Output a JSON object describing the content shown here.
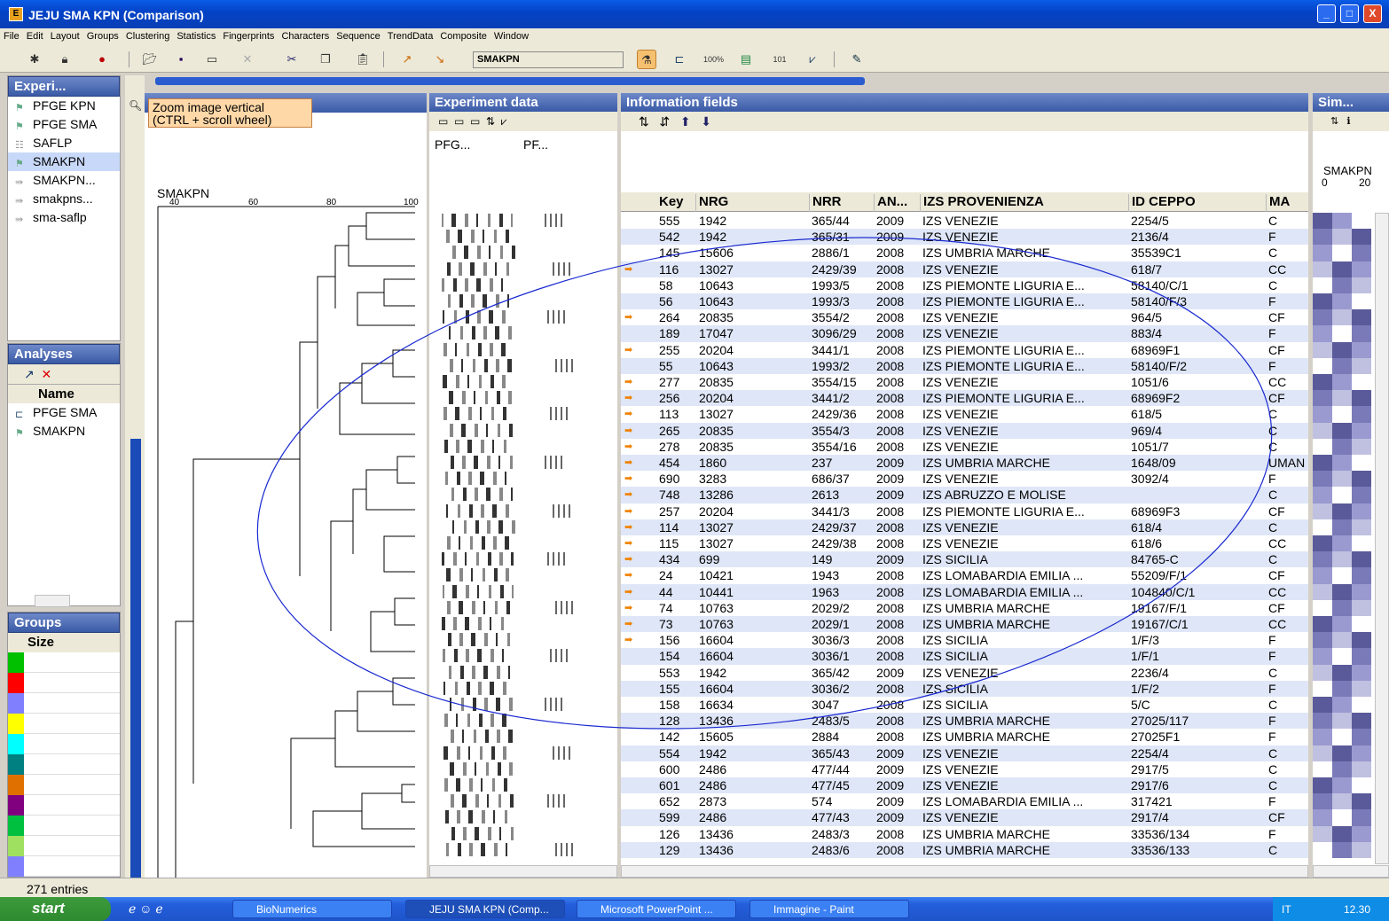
{
  "window": {
    "title": "JEJU SMA KPN (Comparison)",
    "icon_text": "E",
    "min": "_",
    "max": "□",
    "close": "X"
  },
  "menu": [
    "File",
    "Edit",
    "Layout",
    "Groups",
    "Clustering",
    "Statistics",
    "Fingerprints",
    "Characters",
    "Sequence",
    "TrendData",
    "Composite",
    "Window"
  ],
  "toolbar": {
    "db_name": "SMAKPN"
  },
  "experiments": {
    "header": "Experi...",
    "items": [
      {
        "label": "PFGE KPN",
        "icon": "fingerprint-icon"
      },
      {
        "label": "PFGE SMA",
        "icon": "fingerprint-icon"
      },
      {
        "label": "SAFLP",
        "icon": "character-icon"
      },
      {
        "label": "SMAKPN",
        "icon": "composite-icon",
        "selected": true
      },
      {
        "label": "SMAKPN...",
        "icon": "composite-icon"
      },
      {
        "label": "smakpns...",
        "icon": "composite-icon"
      },
      {
        "label": "sma-saflp",
        "icon": "composite-icon"
      }
    ]
  },
  "analyses": {
    "header": "Analyses",
    "col": "Name",
    "items": [
      {
        "label": "PFGE SMA"
      },
      {
        "label": "SMAKPN"
      }
    ]
  },
  "groups": {
    "header": "Groups",
    "col": "Size",
    "colors": [
      "#00c000",
      "#ff0000",
      "#8080ff",
      "#ffff00",
      "#00ffff",
      "#008080",
      "#e07000",
      "#800080",
      "#00c040",
      "#a0e060",
      "#8080ff"
    ]
  },
  "tooltip": {
    "line1": "Zoom image vertical",
    "line2": "(CTRL + scroll wheel)"
  },
  "dendrogram": {
    "label": "SMAKPN",
    "ticks": [
      "40",
      "60",
      "80",
      "100"
    ]
  },
  "experiment_data": {
    "header": "Experiment data",
    "col1": "PFG...",
    "col2": "PF..."
  },
  "info_fields": {
    "header": "Information fields",
    "columns": [
      "Key",
      "NRG",
      "NRR",
      "AN...",
      "IZS PROVENIENZA",
      "ID CEPPO",
      "MA"
    ]
  },
  "similarity": {
    "header": "Sim...",
    "label": "SMAKPN",
    "ticks": [
      "0",
      "20"
    ]
  },
  "rows": [
    [
      "555",
      "1942",
      "365/44",
      "2009",
      "IZS VENEZIE",
      "2254/5",
      "C",
      false
    ],
    [
      "542",
      "1942",
      "365/31",
      "2009",
      "IZS VENEZIE",
      "2136/4",
      "F",
      false
    ],
    [
      "145",
      "15606",
      "2886/1",
      "2008",
      "IZS UMBRIA MARCHE",
      "35539C1",
      "C",
      false
    ],
    [
      "116",
      "13027",
      "2429/39",
      "2008",
      "IZS VENEZIE",
      "618/7",
      "CC",
      true
    ],
    [
      "58",
      "10643",
      "1993/5",
      "2008",
      "IZS PIEMONTE LIGURIA E...",
      "58140/C/1",
      "C",
      false
    ],
    [
      "56",
      "10643",
      "1993/3",
      "2008",
      "IZS PIEMONTE LIGURIA E...",
      "58140/F/3",
      "F",
      false
    ],
    [
      "264",
      "20835",
      "3554/2",
      "2008",
      "IZS VENEZIE",
      "964/5",
      "CF",
      true
    ],
    [
      "189",
      "17047",
      "3096/29",
      "2008",
      "IZS VENEZIE",
      "883/4",
      "F",
      false
    ],
    [
      "255",
      "20204",
      "3441/1",
      "2008",
      "IZS PIEMONTE LIGURIA E...",
      "68969F1",
      "CF",
      true
    ],
    [
      "55",
      "10643",
      "1993/2",
      "2008",
      "IZS PIEMONTE LIGURIA E...",
      "58140/F/2",
      "F",
      false
    ],
    [
      "277",
      "20835",
      "3554/15",
      "2008",
      "IZS VENEZIE",
      "1051/6",
      "CC",
      true
    ],
    [
      "256",
      "20204",
      "3441/2",
      "2008",
      "IZS PIEMONTE LIGURIA E...",
      "68969F2",
      "CF",
      true
    ],
    [
      "113",
      "13027",
      "2429/36",
      "2008",
      "IZS VENEZIE",
      "618/5",
      "C",
      true
    ],
    [
      "265",
      "20835",
      "3554/3",
      "2008",
      "IZS VENEZIE",
      "969/4",
      "C",
      true
    ],
    [
      "278",
      "20835",
      "3554/16",
      "2008",
      "IZS VENEZIE",
      "1051/7",
      "C",
      true
    ],
    [
      "454",
      "1860",
      "237",
      "2009",
      "IZS UMBRIA MARCHE",
      "1648/09",
      "UMAN",
      true
    ],
    [
      "690",
      "3283",
      "686/37",
      "2009",
      "IZS VENEZIE",
      "3092/4",
      "F",
      true
    ],
    [
      "748",
      "13286",
      "2613",
      "2009",
      "IZS ABRUZZO E MOLISE",
      "",
      "C",
      true
    ],
    [
      "257",
      "20204",
      "3441/3",
      "2008",
      "IZS PIEMONTE LIGURIA E...",
      "68969F3",
      "CF",
      true
    ],
    [
      "114",
      "13027",
      "2429/37",
      "2008",
      "IZS VENEZIE",
      "618/4",
      "C",
      true
    ],
    [
      "115",
      "13027",
      "2429/38",
      "2008",
      "IZS VENEZIE",
      "618/6",
      "CC",
      true
    ],
    [
      "434",
      "699",
      "149",
      "2009",
      "IZS SICILIA",
      "84765-C",
      "C",
      true
    ],
    [
      "24",
      "10421",
      "1943",
      "2008",
      "IZS LOMABARDIA EMILIA ...",
      "55209/F/1",
      "CF",
      true
    ],
    [
      "44",
      "10441",
      "1963",
      "2008",
      "IZS LOMABARDIA EMILIA ...",
      "104840/C/1",
      "CC",
      true
    ],
    [
      "74",
      "10763",
      "2029/2",
      "2008",
      "IZS UMBRIA MARCHE",
      "19167/F/1",
      "CF",
      true
    ],
    [
      "73",
      "10763",
      "2029/1",
      "2008",
      "IZS UMBRIA MARCHE",
      "19167/C/1",
      "CC",
      true
    ],
    [
      "156",
      "16604",
      "3036/3",
      "2008",
      "IZS SICILIA",
      "1/F/3",
      "F",
      true
    ],
    [
      "154",
      "16604",
      "3036/1",
      "2008",
      "IZS SICILIA",
      "1/F/1",
      "F",
      false
    ],
    [
      "553",
      "1942",
      "365/42",
      "2009",
      "IZS VENEZIE",
      "2236/4",
      "C",
      false
    ],
    [
      "155",
      "16604",
      "3036/2",
      "2008",
      "IZS SICILIA",
      "1/F/2",
      "F",
      false
    ],
    [
      "158",
      "16634",
      "3047",
      "2008",
      "IZS SICILIA",
      "5/C",
      "C",
      false
    ],
    [
      "128",
      "13436",
      "2483/5",
      "2008",
      "IZS UMBRIA MARCHE",
      "27025/117",
      "F",
      false
    ],
    [
      "142",
      "15605",
      "2884",
      "2008",
      "IZS UMBRIA MARCHE",
      "27025F1",
      "F",
      false
    ],
    [
      "554",
      "1942",
      "365/43",
      "2009",
      "IZS VENEZIE",
      "2254/4",
      "C",
      false
    ],
    [
      "600",
      "2486",
      "477/44",
      "2009",
      "IZS VENEZIE",
      "2917/5",
      "C",
      false
    ],
    [
      "601",
      "2486",
      "477/45",
      "2009",
      "IZS VENEZIE",
      "2917/6",
      "C",
      false
    ],
    [
      "652",
      "2873",
      "574",
      "2009",
      "IZS LOMABARDIA EMILIA ...",
      "317421",
      "F",
      false
    ],
    [
      "599",
      "2486",
      "477/43",
      "2009",
      "IZS VENEZIE",
      "2917/4",
      "CF",
      false
    ],
    [
      "126",
      "13436",
      "2483/3",
      "2008",
      "IZS UMBRIA MARCHE",
      "33536/134",
      "F",
      false
    ],
    [
      "129",
      "13436",
      "2483/6",
      "2008",
      "IZS UMBRIA MARCHE",
      "33536/133",
      "C",
      false
    ]
  ],
  "status": {
    "entries": "271 entries"
  },
  "taskbar": {
    "start": "start",
    "tasks": [
      "BioNumerics",
      "JEJU SMA KPN (Comp...",
      "Microsoft PowerPoint ...",
      "Immagine - Paint"
    ],
    "lang": "IT",
    "clock": "12.30"
  }
}
